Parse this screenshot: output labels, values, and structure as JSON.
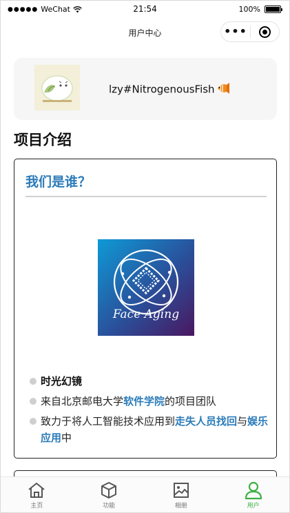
{
  "status_bar": {
    "carrier": "WeChat",
    "time": "21:54",
    "battery": "100%",
    "battery_level": 1.0
  },
  "nav": {
    "title": "用户中心",
    "more_glyph": "•••"
  },
  "profile": {
    "username": "lzy#NitrogenousFish",
    "avatar_icon": "avatar-image",
    "badge_icon": "fish-emoji-icon"
  },
  "section": {
    "title": "项目介绍"
  },
  "intro": {
    "heading": "我们是谁？",
    "logo_text": "Face Aging",
    "bullets": [
      {
        "text": "时光幻镜"
      },
      {
        "pre": "来自北京邮电大学",
        "hl1": "软件学院",
        "post": "的项目团队"
      },
      {
        "pre": "致力于将人工智能技术应用到",
        "hl1": "走失人员找回",
        "mid": "与",
        "hl2": "娱乐应用",
        "post": "中"
      }
    ]
  },
  "tabbar": {
    "items": [
      {
        "label": "主页",
        "icon": "home-icon"
      },
      {
        "label": "功能",
        "icon": "cube-icon"
      },
      {
        "label": "相册",
        "icon": "album-icon"
      },
      {
        "label": "用户",
        "icon": "user-icon"
      }
    ],
    "active_index": 3
  },
  "colors": {
    "accent": "#2b7bb9",
    "active_tab": "#3cb043",
    "card_bg": "#f6f6f6"
  }
}
